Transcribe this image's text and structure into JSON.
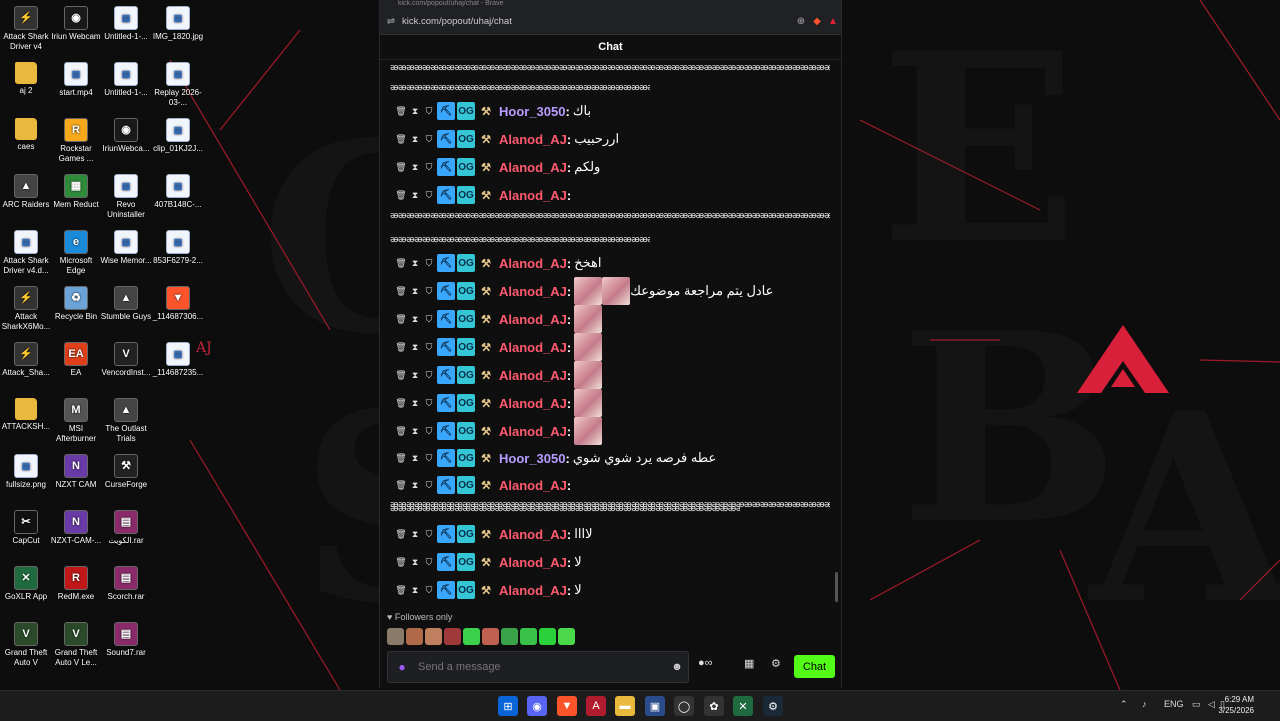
{
  "browser": {
    "title_text": "kick.com/popout/uhaj/chat - Brave",
    "url": "kick.com/popout/uhaj/chat"
  },
  "chat": {
    "header": "Chat",
    "spam_line_1": "ꭂꭂꭂꭂꭂꭂꭂꭂꭂꭂꭂꭂꭂꭂꭂꭂꭂꭂꭂꭂꭂꭂꭂꭂꭂꭂꭂꭂꭂꭂꭂꭂꭂꭂꭂꭂꭂꭂꭂꭂꭂꭂꭂꭂꭂꭂꭂꭂꭂꭂꭂꭂꭂꭂꭂꭂꭂꭂꭂꭂꭂꭂꭂꭂꭂꭂꭂꭂꭂꭂꭂꭂꭂꭂꭂꭂꭂꭂꭂꭂꭂꭂꭂꭂꭂꭂꭂꭂꭂꭂꭂꭂꭂꭂꭂꭂꭂ",
    "spam_line_2": "ꭂꭂꭂꭂꭂꭂꭂꭂꭂꭂꭂꭂꭂꭂꭂꭂꭂꭂꭂꭂꭂꭂꭂꭂꭂꭂꭂꭂꭂꭂꭂꭂꭂꭂꭂꭂꭂꭂꭂꭂꭂꭂꭂꭂꭂꭂꭂꭂꭂꭂꭂꭂꭂꭂꭂꭂꭂꭂꭂꭂꭂꭂꭂꭂꭂ",
    "messages": [
      {
        "user": "Hoor_3050",
        "color": "#b89cff",
        "text": "باك"
      },
      {
        "user": "Alanod_AJ",
        "color": "#ff5a6e",
        "text": "اررحبيب"
      },
      {
        "user": "Alanod_AJ",
        "color": "#ff5a6e",
        "text": "ولكم"
      },
      {
        "user": "Alanod_AJ",
        "color": "#ff5a6e",
        "text": ""
      },
      {
        "user": "Alanod_AJ",
        "color": "#ff5a6e",
        "text": "اهخخ"
      },
      {
        "user": "Alanod_AJ",
        "color": "#ff5a6e",
        "text": "عادل يتم مراجعة موضوعك"
      },
      {
        "user": "Alanod_AJ",
        "color": "#ff5a6e",
        "text": ""
      },
      {
        "user": "Alanod_AJ",
        "color": "#ff5a6e",
        "text": ""
      },
      {
        "user": "Alanod_AJ",
        "color": "#ff5a6e",
        "text": ""
      },
      {
        "user": "Alanod_AJ",
        "color": "#ff5a6e",
        "text": ""
      },
      {
        "user": "Alanod_AJ",
        "color": "#ff5a6e",
        "text": ""
      },
      {
        "user": "Hoor_3050",
        "color": "#b89cff",
        "text": "عطه فرصه يرد شوي شوي"
      },
      {
        "user": "Alanod_AJ",
        "color": "#ff5a6e",
        "text": ""
      },
      {
        "user": "Alanod_AJ",
        "color": "#ff5a6e",
        "text": "لاااا"
      },
      {
        "user": "Alanod_AJ",
        "color": "#ff5a6e",
        "text": "لا"
      },
      {
        "user": "Alanod_AJ",
        "color": "#ff5a6e",
        "text": "لا"
      }
    ],
    "followers_only": "Followers only",
    "input_placeholder": "Send a message",
    "send_label": "Chat"
  },
  "desktop_icons": [
    {
      "label": "Attack Shark Driver v4",
      "icon": "shark-icon"
    },
    {
      "label": "Iriun Webcam",
      "icon": "webcam-icon"
    },
    {
      "label": "Untitled-1-...",
      "icon": "file-icon"
    },
    {
      "label": "IMG_1820.jpg",
      "icon": "file-icon"
    },
    {
      "label": "aj 2",
      "icon": "folder-icon"
    },
    {
      "label": "start.mp4",
      "icon": "file-icon"
    },
    {
      "label": "Untitled-1-...",
      "icon": "file-icon"
    },
    {
      "label": "Replay 2026-03-...",
      "icon": "file-icon"
    },
    {
      "label": "caes",
      "icon": "folder-icon"
    },
    {
      "label": "Rockstar Games ...",
      "icon": "rockstar-icon"
    },
    {
      "label": "IriunWebca...",
      "icon": "webcam-icon"
    },
    {
      "label": "clip_01KJ2J...",
      "icon": "file-icon"
    },
    {
      "label": "ARC Raiders",
      "icon": "game-icon"
    },
    {
      "label": "Mem Reduct",
      "icon": "memory-icon"
    },
    {
      "label": "Revo Uninstaller",
      "icon": "file-icon"
    },
    {
      "label": "407B148C-...",
      "icon": "file-icon"
    },
    {
      "label": "Attack Shark Driver v4.d...",
      "icon": "file-icon"
    },
    {
      "label": "Microsoft Edge",
      "icon": "edge-icon"
    },
    {
      "label": "Wise Memor...",
      "icon": "file-icon"
    },
    {
      "label": "853F6279-2...",
      "icon": "file-icon"
    },
    {
      "label": "Attack SharkX6Mo...",
      "icon": "shark-icon"
    },
    {
      "label": "Recycle Bin",
      "icon": "recycle-bin-icon"
    },
    {
      "label": "Stumble Guys",
      "icon": "game-icon"
    },
    {
      "label": "_114687306...",
      "icon": "brave-icon"
    },
    {
      "label": "Attack_Sha...",
      "icon": "shark-icon"
    },
    {
      "label": "EA",
      "icon": "ea-icon"
    },
    {
      "label": "VencordInst...",
      "icon": "vencord-icon"
    },
    {
      "label": "_114687235...",
      "icon": "file-icon"
    },
    {
      "label": "ATTACKSH...",
      "icon": "folder-icon"
    },
    {
      "label": "MSI Afterburner",
      "icon": "msi-icon"
    },
    {
      "label": "The Outlast Trials",
      "icon": "game-icon"
    },
    {
      "label": "fullsize.png",
      "icon": "file-icon"
    },
    {
      "label": "NZXT CAM",
      "icon": "nzxt-icon"
    },
    {
      "label": "CurseForge",
      "icon": "curseforge-icon"
    },
    {
      "label": "CapCut",
      "icon": "capcut-icon"
    },
    {
      "label": "NZXT-CAM-...",
      "icon": "nzxt-icon"
    },
    {
      "label": "الكويت.rar",
      "icon": "rar-icon"
    },
    {
      "label": "GoXLR App",
      "icon": "goxlr-icon"
    },
    {
      "label": "RedM.exe",
      "icon": "redm-icon"
    },
    {
      "label": "Scorch.rar",
      "icon": "rar-icon"
    },
    {
      "label": "Grand Theft Auto V",
      "icon": "gta-icon"
    },
    {
      "label": "Grand Theft Auto V Le...",
      "icon": "gta-icon"
    },
    {
      "label": "Sound7.rar",
      "icon": "rar-icon"
    }
  ],
  "wallpaper": {
    "aj_text": "AJ"
  },
  "taskbar": {
    "language": "ENG",
    "time": "6:29 AM",
    "date": "3/25/2026"
  },
  "colors": {
    "kick_green": "#53fc18",
    "accent_red": "#e0203a"
  }
}
